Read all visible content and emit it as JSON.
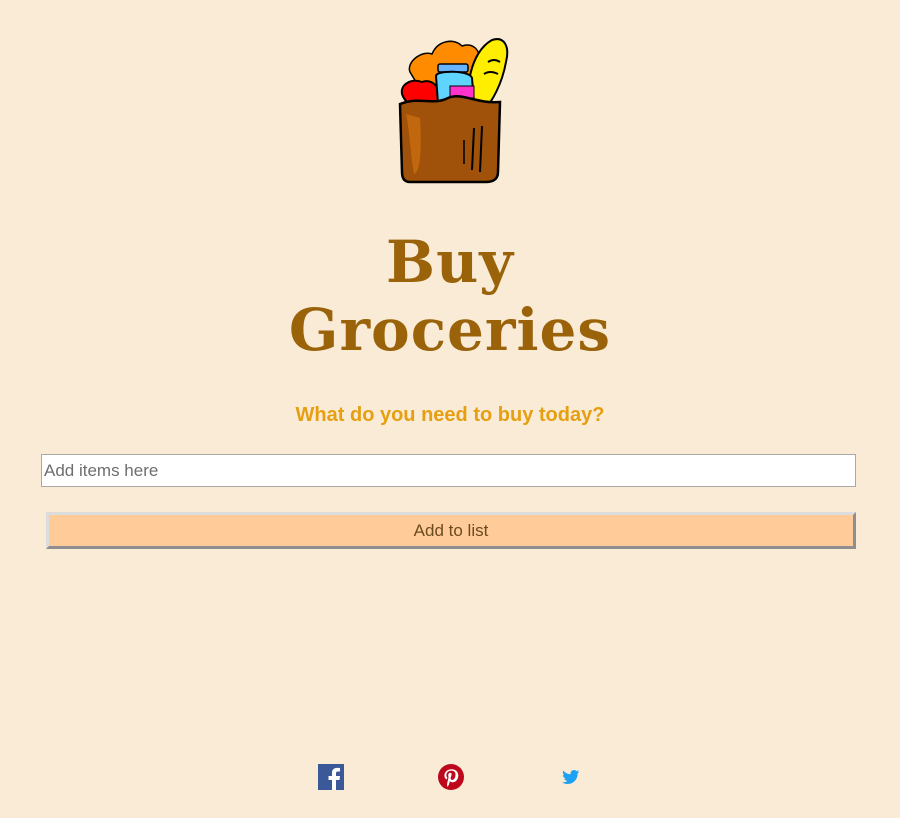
{
  "header": {
    "logo_icon": "grocery-bag-icon",
    "title_line1": "Buy",
    "title_line2": "Groceries",
    "subtitle": "What do you need to buy today?"
  },
  "form": {
    "input_value": "",
    "input_placeholder": "Add items here",
    "add_button_label": "Add to list"
  },
  "footer": {
    "social_icons": [
      "facebook-icon",
      "pinterest-icon",
      "twitter-icon"
    ]
  },
  "colors": {
    "background": "#faebd7",
    "title": "#9a6209",
    "subtitle": "#e59f11",
    "button": "#ffcc99",
    "facebook": "#3b5998",
    "pinterest": "#bd081c",
    "twitter": "#1da1f2"
  }
}
